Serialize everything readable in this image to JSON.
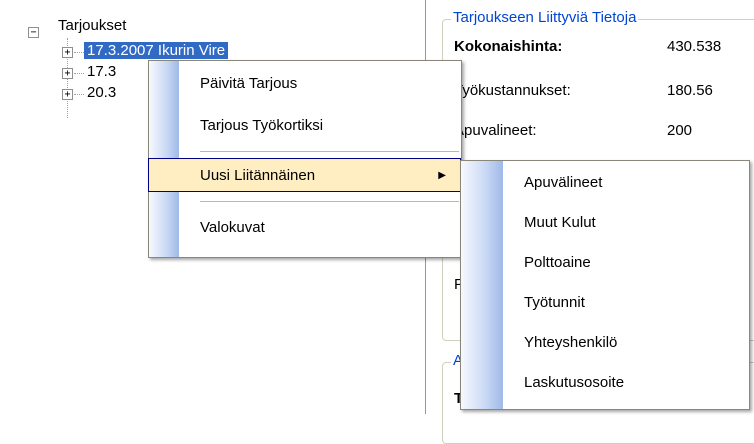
{
  "tree": {
    "root": {
      "label": "Tarjoukset",
      "expander": "−"
    },
    "children": [
      {
        "label": "17.3.2007 Ikurin Vire",
        "expander": "+",
        "selected": true
      },
      {
        "label": "17.3",
        "expander": "+",
        "selected": false
      },
      {
        "label": "20.3",
        "expander": "+",
        "selected": false
      }
    ]
  },
  "details": {
    "group_title": "Tarjoukseen Liittyviä Tietoja",
    "rows": [
      {
        "label": "Kokonaishinta:",
        "value": "430.538"
      },
      {
        "label": "Työkustannukset:",
        "value": "180.56"
      },
      {
        "label": "Apuvalineet:",
        "value": "200"
      }
    ],
    "partial_label": "F",
    "group2_partial_title": "A",
    "group2_partial_label": "T"
  },
  "context_menu": {
    "items": [
      {
        "label": "Päivitä Tarjous"
      },
      {
        "label": "Tarjous Työkortiksi"
      },
      {
        "label": "Uusi Liitännäinen",
        "submenu_arrow": "▶"
      },
      {
        "label": "Valokuvat"
      }
    ]
  },
  "submenu": {
    "items": [
      {
        "label": "Apuvälineet"
      },
      {
        "label": "Muut Kulut"
      },
      {
        "label": "Polttoaine"
      },
      {
        "label": "Työtunnit"
      },
      {
        "label": "Yhteyshenkilö"
      },
      {
        "label": "Laskutusosoite"
      }
    ]
  },
  "colors": {
    "selection": "#316ac5",
    "menu_hover": "#ffeec2",
    "group_title": "#0046d5"
  }
}
